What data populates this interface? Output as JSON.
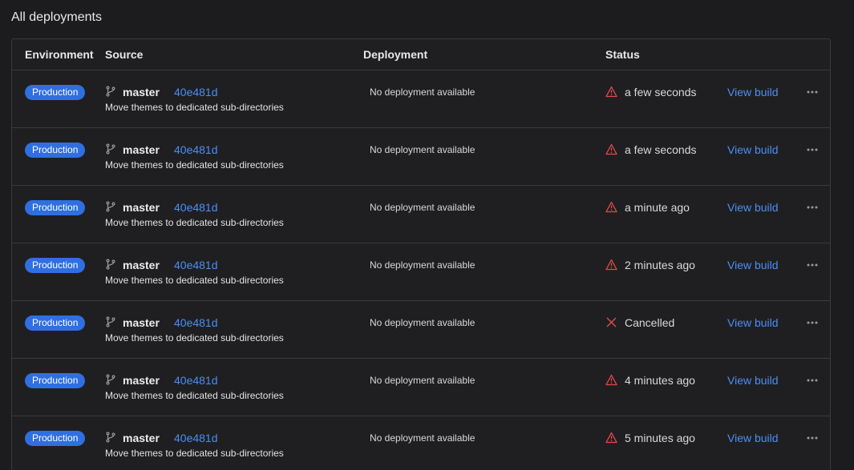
{
  "section": {
    "title": "All deployments"
  },
  "columns": {
    "environment": "Environment",
    "source": "Source",
    "deployment": "Deployment",
    "status": "Status"
  },
  "colors": {
    "accent": "#4b8ef5",
    "badge": "#2f6fe0",
    "error": "#e5484d"
  },
  "rows": [
    {
      "environment": "Production",
      "branch": "master",
      "commit": "40e481d",
      "message": "Move themes to dedicated sub-directories",
      "deployment": "No deployment available",
      "status_icon": "warning-icon",
      "status": "a few seconds",
      "action": "View build"
    },
    {
      "environment": "Production",
      "branch": "master",
      "commit": "40e481d",
      "message": "Move themes to dedicated sub-directories",
      "deployment": "No deployment available",
      "status_icon": "warning-icon",
      "status": "a few seconds",
      "action": "View build"
    },
    {
      "environment": "Production",
      "branch": "master",
      "commit": "40e481d",
      "message": "Move themes to dedicated sub-directories",
      "deployment": "No deployment available",
      "status_icon": "warning-icon",
      "status": "a minute ago",
      "action": "View build"
    },
    {
      "environment": "Production",
      "branch": "master",
      "commit": "40e481d",
      "message": "Move themes to dedicated sub-directories",
      "deployment": "No deployment available",
      "status_icon": "warning-icon",
      "status": "2 minutes ago",
      "action": "View build"
    },
    {
      "environment": "Production",
      "branch": "master",
      "commit": "40e481d",
      "message": "Move themes to dedicated sub-directories",
      "deployment": "No deployment available",
      "status_icon": "cancel-icon",
      "status": "Cancelled",
      "action": "View build"
    },
    {
      "environment": "Production",
      "branch": "master",
      "commit": "40e481d",
      "message": "Move themes to dedicated sub-directories",
      "deployment": "No deployment available",
      "status_icon": "warning-icon",
      "status": "4 minutes ago",
      "action": "View build"
    },
    {
      "environment": "Production",
      "branch": "master",
      "commit": "40e481d",
      "message": "Move themes to dedicated sub-directories",
      "deployment": "No deployment available",
      "status_icon": "warning-icon",
      "status": "5 minutes ago",
      "action": "View build"
    }
  ]
}
